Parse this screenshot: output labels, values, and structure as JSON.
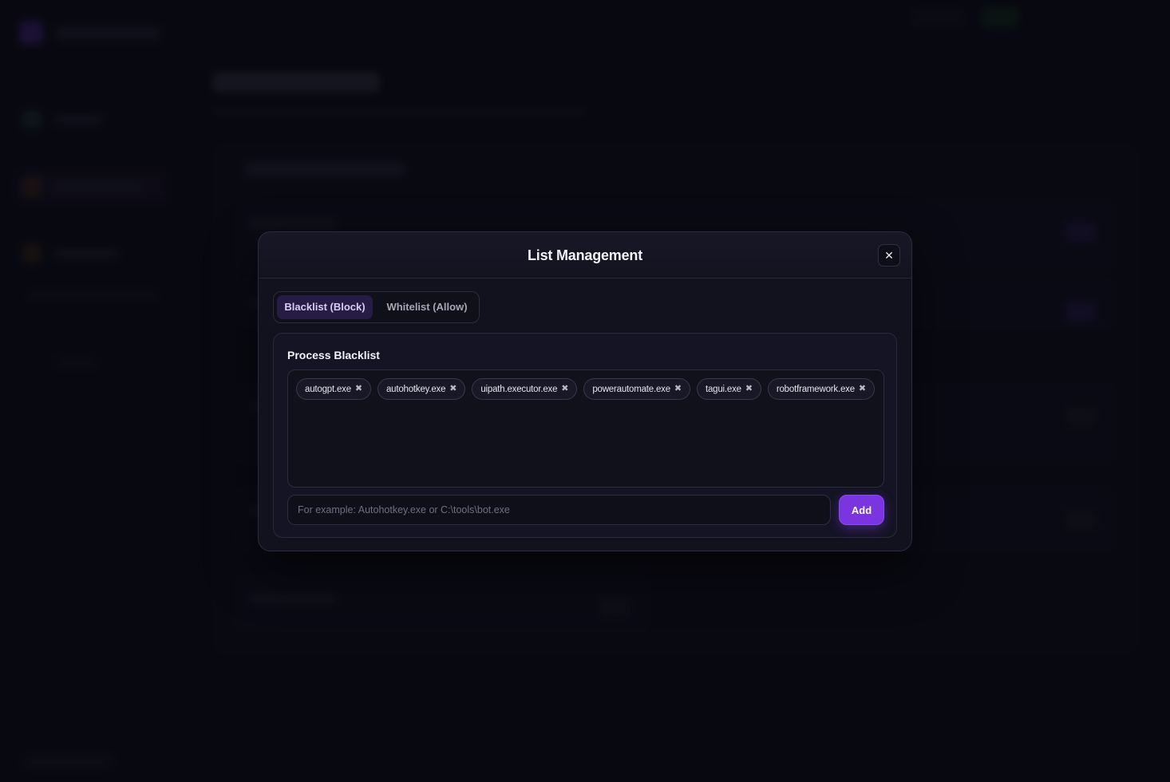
{
  "modal": {
    "title": "List Management",
    "close_icon": "✕",
    "tabs": [
      {
        "label": "Blacklist (Block)",
        "active": true
      },
      {
        "label": "Whitelist (Allow)",
        "active": false
      }
    ],
    "section_title": "Process Blacklist",
    "tags": [
      {
        "label": "autogpt.exe"
      },
      {
        "label": "autohotkey.exe"
      },
      {
        "label": "uipath.executor.exe"
      },
      {
        "label": "powerautomate.exe"
      },
      {
        "label": "tagui.exe"
      },
      {
        "label": "robotframework.exe"
      }
    ],
    "tag_remove_icon": "✖",
    "input": {
      "value": "",
      "placeholder": "For example: Autohotkey.exe or C:\\tools\\bot.exe"
    },
    "add_label": "Add"
  },
  "colors": {
    "accent": "#7a34e0",
    "active_tab_bg": "#261c44",
    "background": "#0b0b14"
  }
}
